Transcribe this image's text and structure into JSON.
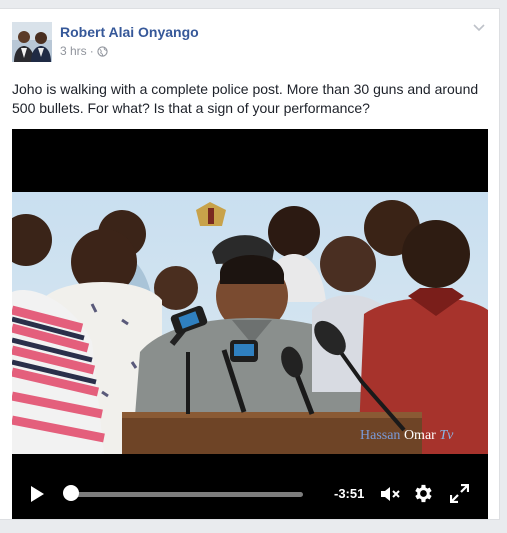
{
  "post": {
    "author": "Robert Alai Onyango",
    "time": "3 hrs",
    "separator": "·",
    "privacy_icon": "globe-icon",
    "menu_icon": "chevron-down-icon",
    "text": "Joho is walking with a complete police post. More than 30 guns and around 500 bullets. For what? Is that a sign of your performance?"
  },
  "video": {
    "watermark": {
      "part1": "Hassan",
      "part2": "Omar",
      "part3": "Tv"
    },
    "time_remaining": "-3:51",
    "progress": 0.0,
    "icons": {
      "play": "play-icon",
      "mute": "volume-muted-icon",
      "settings": "gear-icon",
      "fullscreen": "fullscreen-icon"
    }
  },
  "colors": {
    "link": "#365899",
    "meta": "#90949c",
    "text": "#1d2129",
    "page_bg": "#e9ebee"
  }
}
